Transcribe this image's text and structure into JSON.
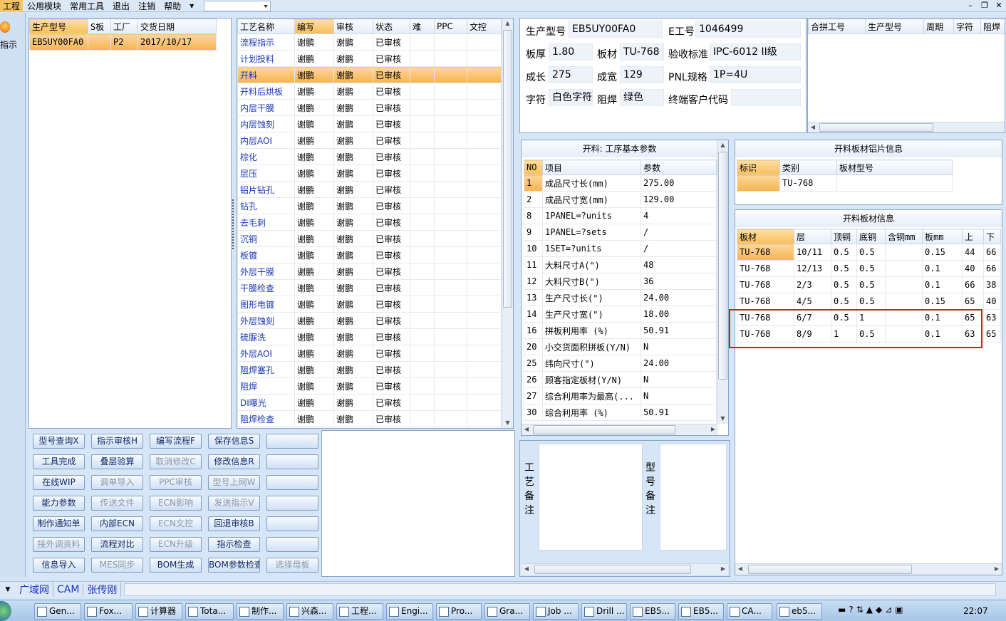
{
  "menu": {
    "items": [
      "工程",
      "公用模块",
      "常用工具",
      "退出",
      "注销",
      "帮助"
    ]
  },
  "leftstrip": {
    "label": "指示"
  },
  "order_list": {
    "columns": [
      "生产型号",
      "S板",
      "工厂",
      "交货日期"
    ],
    "rows": [
      [
        "EB5UY00FA0",
        "",
        "P2",
        "2017/10/17"
      ]
    ]
  },
  "process": {
    "columns": [
      "工艺名称",
      "编写",
      "审核",
      "状态",
      "难",
      "PPC",
      "文控"
    ],
    "rows": [
      [
        "流程指示",
        "谢鹏",
        "谢鹏",
        "已审核"
      ],
      [
        "计划投料",
        "谢鹏",
        "谢鹏",
        "已审核"
      ],
      [
        "开料",
        "谢鹏",
        "谢鹏",
        "已审核"
      ],
      [
        "开料后烘板",
        "谢鹏",
        "谢鹏",
        "已审核"
      ],
      [
        "内层干膜",
        "谢鹏",
        "谢鹏",
        "已审核"
      ],
      [
        "内层蚀刻",
        "谢鹏",
        "谢鹏",
        "已审核"
      ],
      [
        "内层AOI",
        "谢鹏",
        "谢鹏",
        "已审核"
      ],
      [
        "棕化",
        "谢鹏",
        "谢鹏",
        "已审核"
      ],
      [
        "层压",
        "谢鹏",
        "谢鹏",
        "已审核"
      ],
      [
        "铝片钻孔",
        "谢鹏",
        "谢鹏",
        "已审核"
      ],
      [
        "钻孔",
        "谢鹏",
        "谢鹏",
        "已审核"
      ],
      [
        "去毛刺",
        "谢鹏",
        "谢鹏",
        "已审核"
      ],
      [
        "沉铜",
        "谢鹏",
        "谢鹏",
        "已审核"
      ],
      [
        "板镀",
        "谢鹏",
        "谢鹏",
        "已审核"
      ],
      [
        "外层干膜",
        "谢鹏",
        "谢鹏",
        "已审核"
      ],
      [
        "干膜检查",
        "谢鹏",
        "谢鹏",
        "已审核"
      ],
      [
        "图形电镀",
        "谢鹏",
        "谢鹏",
        "已审核"
      ],
      [
        "外层蚀刻",
        "谢鹏",
        "谢鹏",
        "已审核"
      ],
      [
        "硫脲洗",
        "谢鹏",
        "谢鹏",
        "已审核"
      ],
      [
        "外层AOI",
        "谢鹏",
        "谢鹏",
        "已审核"
      ],
      [
        "阻焊塞孔",
        "谢鹏",
        "谢鹏",
        "已审核"
      ],
      [
        "阻焊",
        "谢鹏",
        "谢鹏",
        "已审核"
      ],
      [
        "DI曝光",
        "谢鹏",
        "谢鹏",
        "已审核"
      ],
      [
        "阻焊检查",
        "谢鹏",
        "谢鹏",
        "已审核"
      ]
    ]
  },
  "buttons": [
    [
      "型号查询X",
      "指示审核H",
      "编写流程F",
      "保存信息S",
      ""
    ],
    [
      "工具完成",
      "叠层验算",
      "取消修改C",
      "修改信息R",
      ""
    ],
    [
      "在线WIP",
      "调单导入",
      "PPC审核",
      "型号上网W",
      ""
    ],
    [
      "能力参数",
      "传送文件",
      "ECN影响",
      "发送指示V",
      ""
    ],
    [
      "制作通知单",
      "内部ECN",
      "ECN文控",
      "回退审核B",
      ""
    ],
    [
      "接外调资料",
      "流程对比",
      "ECN升级",
      "指示检查",
      ""
    ],
    [
      "信息导入",
      "MES同步",
      "BOM生成",
      "BOM参数检查",
      "选择母板"
    ]
  ],
  "info": {
    "prod_model_label": "生产型号",
    "prod_model": "EB5UY00FA0",
    "eng_label": "E工号",
    "eng": "1046499",
    "thickness_label": "板厚",
    "thickness": "1.80",
    "material_label": "板材",
    "material": "TU-768",
    "std_label": "验收标准",
    "std": "IPC-6012 II级",
    "length_label": "成长",
    "length": "275",
    "width_label": "成宽",
    "width": "129",
    "pnl_label": "PNL规格",
    "pnl": "1P=4U",
    "char_label": "字符",
    "char": "白色字符",
    "mask_label": "阻焊",
    "mask": "绿色",
    "customer_label": "终端客户代码",
    "customer": ""
  },
  "merge": {
    "columns": [
      "合拼工号",
      "生产型号",
      "周期",
      "字符",
      "阻焊"
    ]
  },
  "params": {
    "title": "开料: 工序基本参数",
    "columns": [
      "NO",
      "项目",
      "参数"
    ],
    "rows": [
      [
        "1",
        "成品尺寸长(mm)",
        "275.00"
      ],
      [
        "2",
        "成品尺寸宽(mm)",
        "129.00"
      ],
      [
        "8",
        "1PANEL=?units",
        "4"
      ],
      [
        "9",
        "1PANEL=?sets",
        "/"
      ],
      [
        "10",
        "1SET=?units",
        "/"
      ],
      [
        "11",
        "大料尺寸A(\")",
        "48"
      ],
      [
        "12",
        "大料尺寸B(\")",
        "36"
      ],
      [
        "13",
        "生产尺寸长(\")",
        "24.00"
      ],
      [
        "14",
        "生产尺寸宽(\")",
        "18.00"
      ],
      [
        "16",
        "拼板利用率 (%)",
        "50.91"
      ],
      [
        "20",
        "小交货面积拼板(Y/N)",
        "N"
      ],
      [
        "25",
        "纬向尺寸(\")",
        "24.00"
      ],
      [
        "26",
        "顾客指定板材(Y/N)",
        "N"
      ],
      [
        "27",
        "综合利用率为最高(...",
        "N"
      ],
      [
        "30",
        "综合利用率 (%)",
        "50.91"
      ]
    ]
  },
  "alu": {
    "title": "开料板材铝片信息",
    "columns": [
      "标识",
      "类别",
      "板材型号"
    ],
    "rows": [
      [
        "",
        "TU-768",
        ""
      ]
    ]
  },
  "sheet": {
    "title": "开料板材信息",
    "columns": [
      "板材",
      "层",
      "顶铜",
      "底铜",
      "含铜mm",
      "板mm",
      "上",
      "下"
    ],
    "rows": [
      [
        "TU-768",
        "10/11",
        "0.5",
        "0.5",
        "",
        "0.15",
        "44",
        "66"
      ],
      [
        "TU-768",
        "12/13",
        "0.5",
        "0.5",
        "",
        "0.1",
        "40",
        "66"
      ],
      [
        "TU-768",
        "2/3",
        "0.5",
        "0.5",
        "",
        "0.1",
        "66",
        "38"
      ],
      [
        "TU-768",
        "4/5",
        "0.5",
        "0.5",
        "",
        "0.15",
        "65",
        "40"
      ],
      [
        "TU-768",
        "6/7",
        "0.5",
        "1",
        "",
        "0.1",
        "65",
        "63"
      ],
      [
        "TU-768",
        "8/9",
        "1",
        "0.5",
        "",
        "0.1",
        "63",
        "65"
      ]
    ]
  },
  "notes": {
    "process_label": "工艺备注",
    "model_label": "型号备注"
  },
  "status": {
    "items": [
      "广域网",
      "CAM",
      "张传刚"
    ]
  },
  "taskbar": {
    "items": [
      "Gen...",
      "Fox...",
      "计算器",
      "Tota...",
      "制作...",
      "兴森...",
      "工程...",
      "Engi...",
      "Pro...",
      "Gra...",
      "Job ...",
      "Drill ...",
      "EB5...",
      "EB5...",
      "CA...",
      "eb5..."
    ],
    "clock": "22:07"
  }
}
